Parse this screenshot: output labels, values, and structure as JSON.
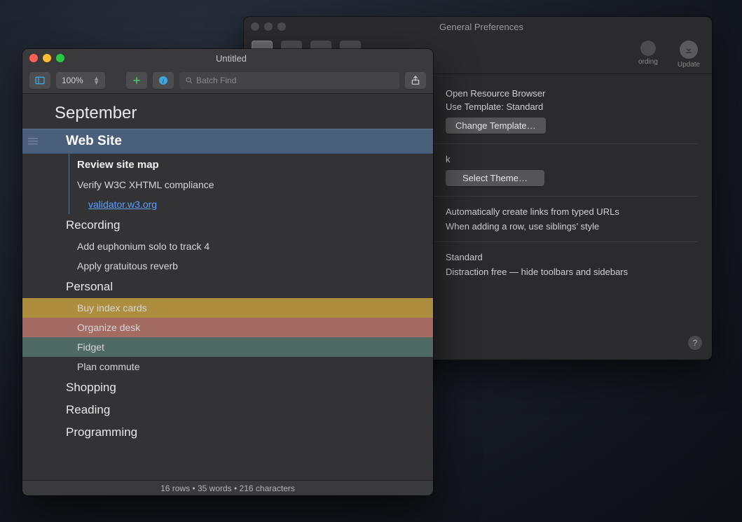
{
  "prefs": {
    "title": "General Preferences",
    "toolbar": [
      {
        "name": "general",
        "label": ""
      },
      {
        "name": "keyboard",
        "label": ""
      },
      {
        "name": "doc1",
        "label": ""
      },
      {
        "name": "doc2",
        "label": ""
      },
      {
        "name": "recording",
        "label": "ording"
      },
      {
        "name": "update",
        "label": "Update"
      }
    ],
    "section_new_doc": {
      "line1": "Open Resource Browser",
      "line2": "Use Template: Standard",
      "button": "Change Template…"
    },
    "section_theme": {
      "label": "k",
      "button": "Select Theme…"
    },
    "section_links": {
      "line1": "Automatically create links from typed URLs",
      "line2": "When adding a row, use siblings’ style"
    },
    "section_fullscreen": {
      "line1": "Standard",
      "line2": "Distraction free — hide toolbars and sidebars"
    },
    "help": "?"
  },
  "main": {
    "title": "Untitled",
    "zoom": "100%",
    "search_placeholder": "Batch Find",
    "heading": "September",
    "section1": {
      "title": "Web Site",
      "sub1": "Review site map",
      "item1": "Verify W3C XHTML compliance",
      "link": "validator.w3.org"
    },
    "section_recording": {
      "title": "Recording",
      "item1": "Add euphonium solo to track 4",
      "item2": "Apply gratuitous reverb"
    },
    "section_personal": {
      "title": "Personal",
      "item1": "Buy index cards",
      "item2": "Organize desk",
      "item3": "Fidget",
      "item4": "Plan commute"
    },
    "cats": [
      "Shopping",
      "Reading",
      "Programming"
    ],
    "status": {
      "rows": "16 rows",
      "words": "35 words",
      "chars": "216 characters"
    }
  },
  "colors": {
    "accent_selected": "#4a5f7c",
    "hl_yellow": "#ad8d3e",
    "hl_rose": "#a46b62",
    "hl_teal": "#4e6a62",
    "link": "#5da0ff"
  }
}
